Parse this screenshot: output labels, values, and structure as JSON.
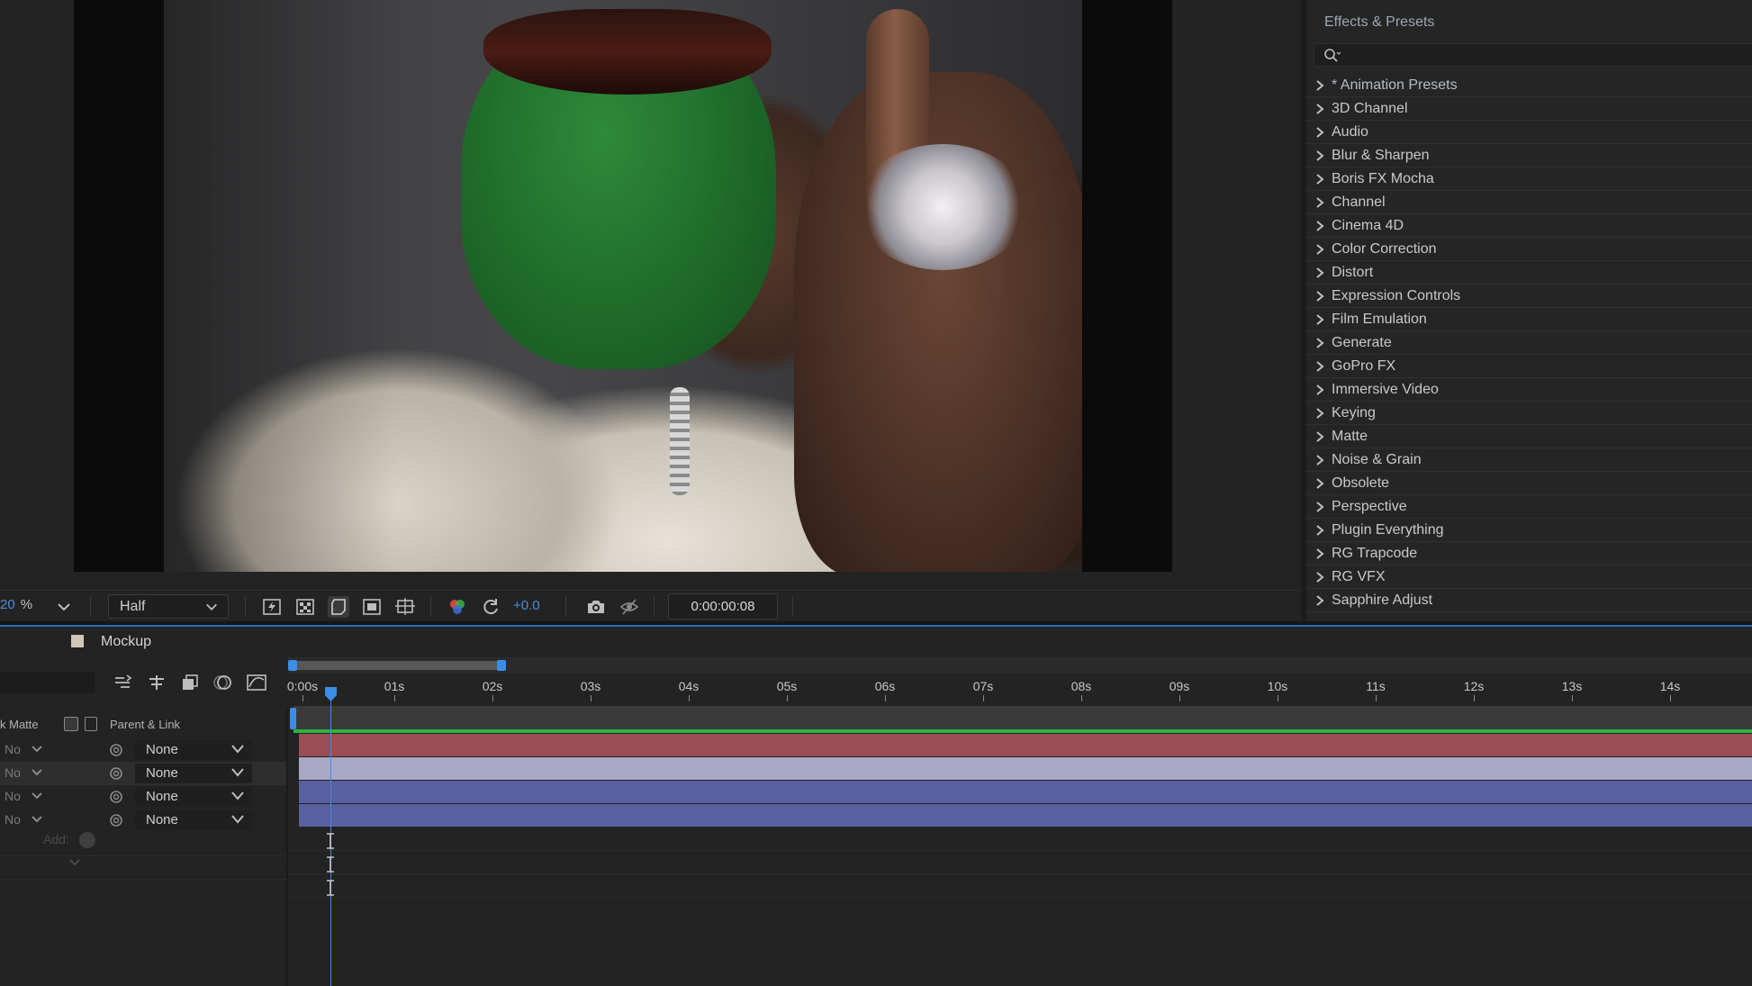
{
  "viewer": {
    "zoom_value": "20",
    "zoom_unit": "%",
    "resolution": "Half",
    "exposure": "+0.0",
    "timecode": "0:00:00:08"
  },
  "effects_panel": {
    "title": "Effects & Presets",
    "search_placeholder": "",
    "categories": [
      "* Animation Presets",
      "3D Channel",
      "Audio",
      "Blur & Sharpen",
      "Boris FX Mocha",
      "Channel",
      "Cinema 4D",
      "Color Correction",
      "Distort",
      "Expression Controls",
      "Film Emulation",
      "Generate",
      "GoPro FX",
      "Immersive Video",
      "Keying",
      "Matte",
      "Noise & Grain",
      "Obsolete",
      "Perspective",
      "Plugin Everything",
      "RG Trapcode",
      "RG VFX",
      "Sapphire Adjust"
    ]
  },
  "timeline": {
    "comp_name": "Mockup",
    "columns": {
      "track_matte": "k Matte",
      "parent_link": "Parent & Link"
    },
    "layers": [
      {
        "matte": "No",
        "parent": "None"
      },
      {
        "matte": "No",
        "parent": "None"
      },
      {
        "matte": "No",
        "parent": "None"
      },
      {
        "matte": "No",
        "parent": "None"
      }
    ],
    "add_label": "Add:",
    "ruler_labels": [
      "0:00s",
      "01s",
      "02s",
      "03s",
      "04s",
      "05s",
      "06s",
      "07s",
      "08s",
      "09s",
      "10s",
      "11s",
      "12s",
      "13s",
      "14s"
    ]
  },
  "colors": {
    "accent_blue": "#3b8ee6",
    "track_green": "#2db53b",
    "layer_red": "#9a4d55",
    "layer_lavender": "#a9a7c6",
    "layer_blue": "#5860a0"
  }
}
